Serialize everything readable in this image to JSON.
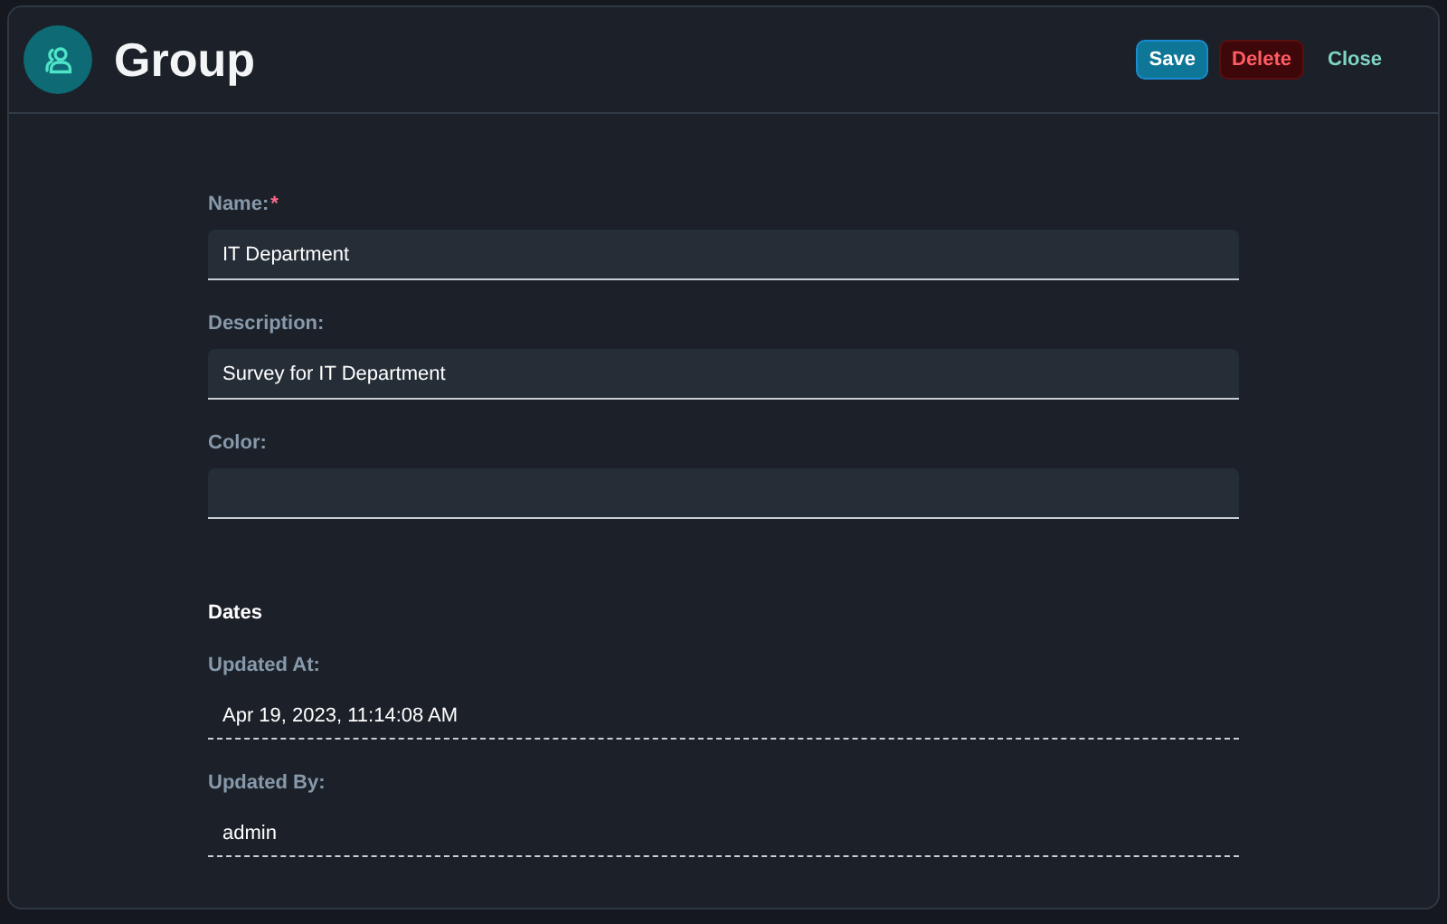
{
  "window": {
    "title": "Group"
  },
  "actions": [
    {
      "label": "Save",
      "kind": "primary"
    },
    {
      "label": "Delete",
      "kind": "danger"
    },
    {
      "label": "Close",
      "kind": "plain"
    }
  ],
  "fields": [
    {
      "label": "Name:",
      "marker": "*",
      "value": "IT Department"
    },
    {
      "label": "Description:",
      "value": "Survey for IT Department"
    },
    {
      "label": "Color:"
    }
  ],
  "dates": {
    "title": "Dates",
    "items": [
      {
        "label": "Updated At:",
        "value": "Apr 19, 2023, 11:14:08 AM"
      },
      {
        "label": "Updated By:",
        "value": "admin"
      }
    ]
  }
}
